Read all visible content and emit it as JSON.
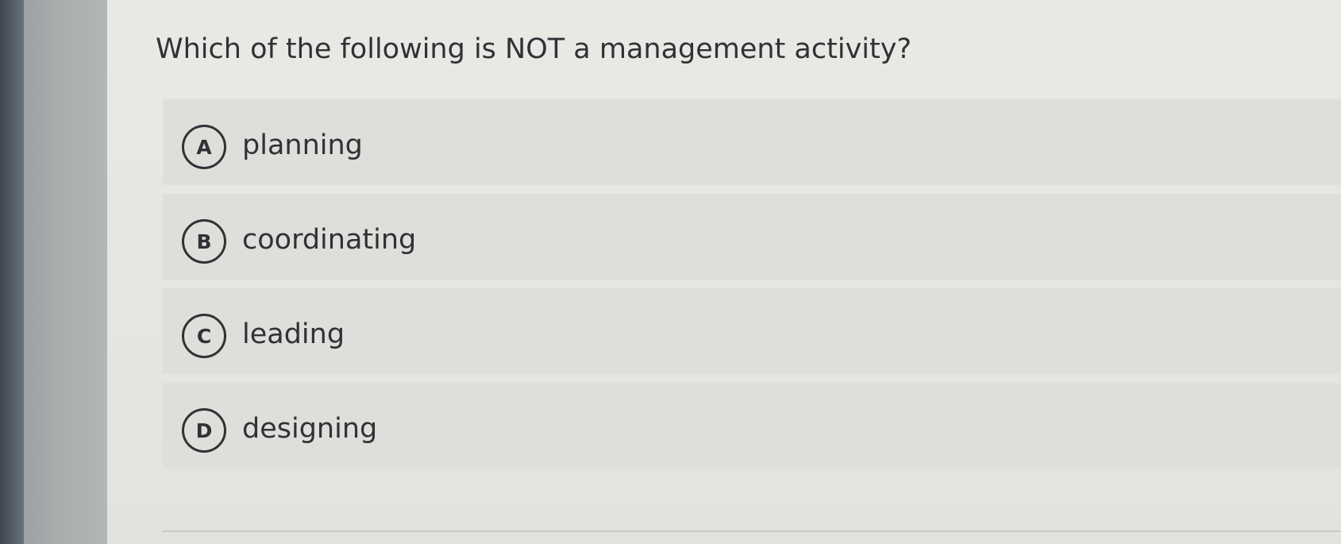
{
  "question": {
    "text": "Which of the following is NOT a management activity?"
  },
  "options": [
    {
      "letter": "A",
      "text": "planning"
    },
    {
      "letter": "B",
      "text": "coordinating"
    },
    {
      "letter": "C",
      "text": "leading"
    },
    {
      "letter": "D",
      "text": "designing"
    }
  ]
}
